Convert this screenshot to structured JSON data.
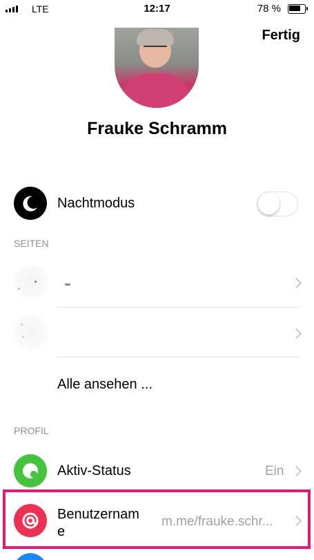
{
  "status_bar": {
    "carrier": "LTE",
    "time": "12:17",
    "battery_percent": "78 %",
    "battery_level": 0.78
  },
  "header": {
    "done_label": "Fertig"
  },
  "profile": {
    "name": "Frauke Schramm"
  },
  "night_mode": {
    "label": "Nachtmodus",
    "enabled": false
  },
  "pages_section": {
    "header": "SEITEN",
    "see_all_label": "Alle ansehen ..."
  },
  "profile_section": {
    "header": "PROFIL",
    "active_status": {
      "label": "Aktiv-Status",
      "value": "Ein",
      "icon_color": "#44c33c"
    },
    "username": {
      "label_line1": "Benutzernam",
      "label_line2": "e",
      "value": "m.me/frauke.schr..."
    }
  },
  "colors": {
    "highlight": "#e6197b",
    "username_icon": "#ee3152",
    "next_icon": "#1e86f5"
  }
}
